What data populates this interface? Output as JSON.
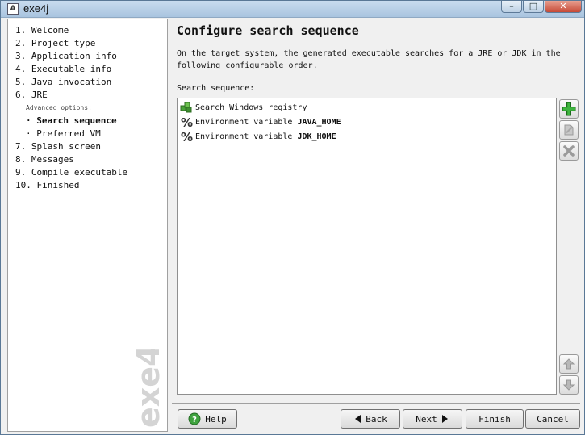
{
  "window": {
    "title": "exe4j",
    "min": "–",
    "max": "□",
    "close": "✕"
  },
  "steps": [
    {
      "num": "1.",
      "label": "Welcome"
    },
    {
      "num": "2.",
      "label": "Project type"
    },
    {
      "num": "3.",
      "label": "Application info"
    },
    {
      "num": "4.",
      "label": "Executable info"
    },
    {
      "num": "5.",
      "label": "Java invocation"
    },
    {
      "num": "6.",
      "label": "JRE"
    },
    {
      "num": "7.",
      "label": "Splash screen"
    },
    {
      "num": "8.",
      "label": "Messages"
    },
    {
      "num": "9.",
      "label": "Compile executable"
    },
    {
      "num": "10.",
      "label": "Finished"
    }
  ],
  "advanced_label": "Advanced options:",
  "substeps": [
    {
      "label": "· Search sequence",
      "active": true
    },
    {
      "label": "· Preferred VM",
      "active": false
    }
  ],
  "logo_text": "exe4j",
  "page": {
    "title": "Configure search sequence",
    "description": "On the target system, the generated executable searches for a JRE or JDK in the following configurable order.",
    "list_label": "Search sequence:"
  },
  "sequence": [
    {
      "prefix": "Search Windows registry",
      "bold": "",
      "icon": "registry-icon"
    },
    {
      "prefix": "Environment variable ",
      "bold": "JAVA_HOME",
      "icon": "percent-icon"
    },
    {
      "prefix": "Environment variable ",
      "bold": "JDK_HOME",
      "icon": "percent-icon"
    }
  ],
  "buttons": {
    "help": "Help",
    "back": "Back",
    "next": "Next",
    "finish": "Finish",
    "cancel": "Cancel"
  },
  "colors": {
    "accent_green": "#2e9a2e",
    "title_bar": "#b9d1ea"
  }
}
